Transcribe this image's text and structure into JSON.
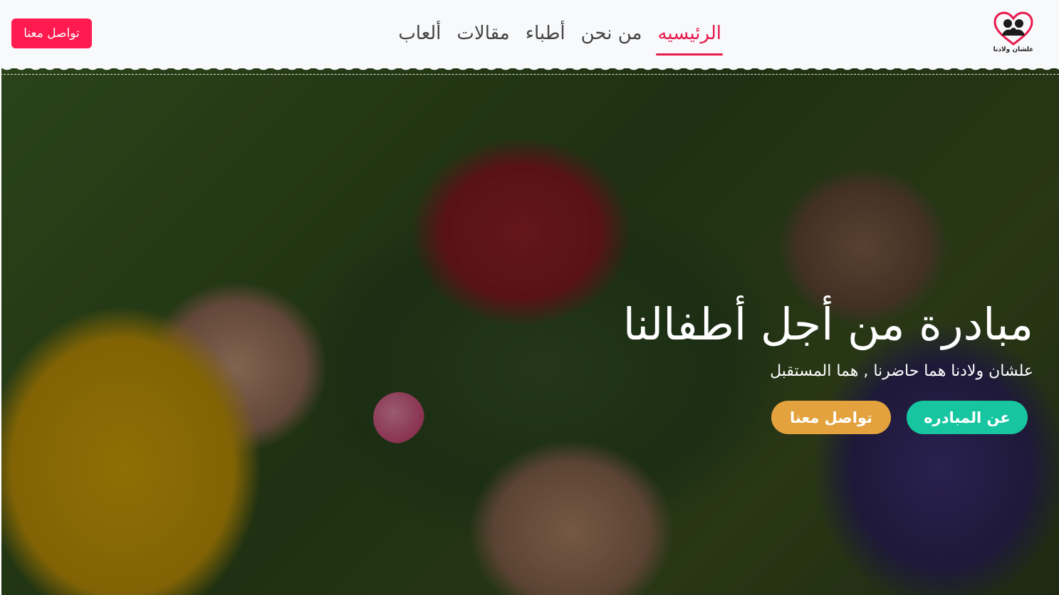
{
  "logo": {
    "text": "علشان ولادنا",
    "icon": "heart-family-icon",
    "color": "#e8194b"
  },
  "nav": {
    "items": [
      {
        "label": "الرئيسيه",
        "active": true
      },
      {
        "label": "من نحن",
        "active": false
      },
      {
        "label": "أطباء",
        "active": false
      },
      {
        "label": "مقالات",
        "active": false
      },
      {
        "label": "ألعاب",
        "active": false
      }
    ]
  },
  "header": {
    "contact_label": "تواصل معنا"
  },
  "hero": {
    "title": "مبادرة من أجل أطفالنا",
    "subtitle": "علشان ولادنا هما حاضرنا , هما المستقبل",
    "about_label": "عن المبادره",
    "contact_label": "تواصل معنا"
  },
  "colors": {
    "accent": "#e8194b",
    "contact_button": "#ff1a4f",
    "about_button": "#17c6a1",
    "hero_contact_button": "#e3a23d"
  }
}
